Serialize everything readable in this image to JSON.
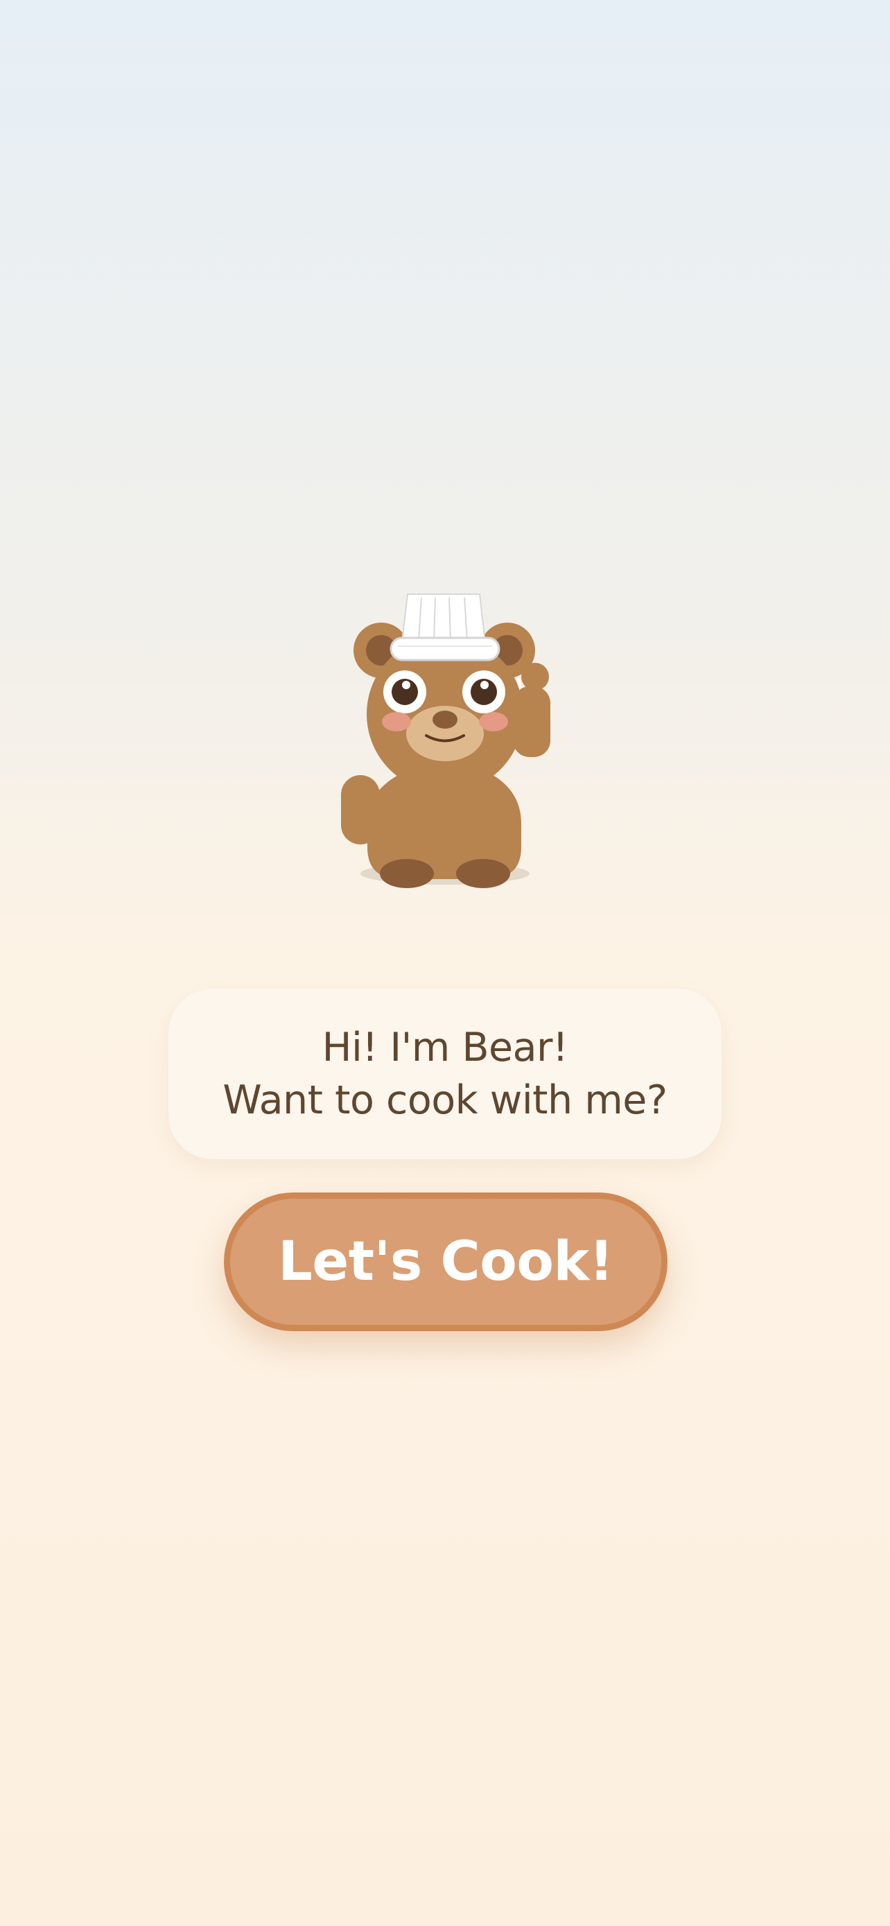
{
  "mascot": {
    "name": "Bear",
    "icon": "chef-bear-waving-icon"
  },
  "bubble": {
    "line1": "Hi! I'm Bear!",
    "line2": "Want to cook with me?"
  },
  "cta": {
    "label": "Let's Cook!"
  },
  "colors": {
    "background_top": "#e6eff6",
    "background_bottom": "#fcefdf",
    "bubble": "#fdf6ec",
    "text": "#5e4630",
    "button_fill": "#d99e73",
    "button_border": "#cf8854",
    "bear_fur": "#b7834f",
    "bear_dark": "#8a5c38",
    "bear_muzzle": "#dfb98e"
  }
}
